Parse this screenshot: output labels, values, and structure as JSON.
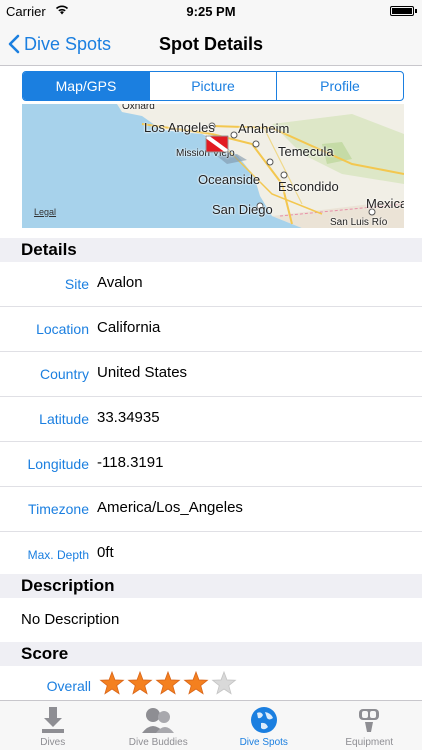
{
  "status_bar": {
    "carrier": "Carrier",
    "time": "9:25 PM"
  },
  "nav": {
    "back_label": "Dive Spots",
    "title": "Spot Details"
  },
  "segments": [
    {
      "label": "Map/GPS",
      "selected": true
    },
    {
      "label": "Picture",
      "selected": false
    },
    {
      "label": "Profile",
      "selected": false
    }
  ],
  "map": {
    "labels": [
      "Oxnard",
      "Los Angeles",
      "Anaheim",
      "Mission Viejo",
      "Temecula",
      "Oceanside",
      "Escondido",
      "San Diego",
      "Mexicali",
      "San Luis Río"
    ],
    "legal": "Legal"
  },
  "details": {
    "header": "Details",
    "rows": [
      {
        "key": "Site",
        "value": "Avalon"
      },
      {
        "key": "Location",
        "value": "California"
      },
      {
        "key": "Country",
        "value": "United States"
      },
      {
        "key": "Latitude",
        "value": "33.34935"
      },
      {
        "key": "Longitude",
        "value": "-118.3191"
      },
      {
        "key": "Timezone",
        "value": "America/Los_Angeles"
      },
      {
        "key": "Max. Depth",
        "value": "0ft"
      }
    ]
  },
  "description": {
    "header": "Description",
    "text": "No Description"
  },
  "score": {
    "header": "Score",
    "label": "Overall",
    "rating": 4,
    "max": 5
  },
  "tabs": [
    {
      "label": "Dives",
      "icon": "download-arrow-icon",
      "active": false
    },
    {
      "label": "Dive Buddies",
      "icon": "buddies-icon",
      "active": false
    },
    {
      "label": "Dive Spots",
      "icon": "globe-icon",
      "active": true
    },
    {
      "label": "Equipment",
      "icon": "scuba-mask-icon",
      "active": false
    }
  ],
  "colors": {
    "accent": "#1b7fe0",
    "star_filled": "#f4801f",
    "star_empty": "#d9d9d9",
    "water": "#a7d2eb",
    "land": "#f1efe6"
  }
}
